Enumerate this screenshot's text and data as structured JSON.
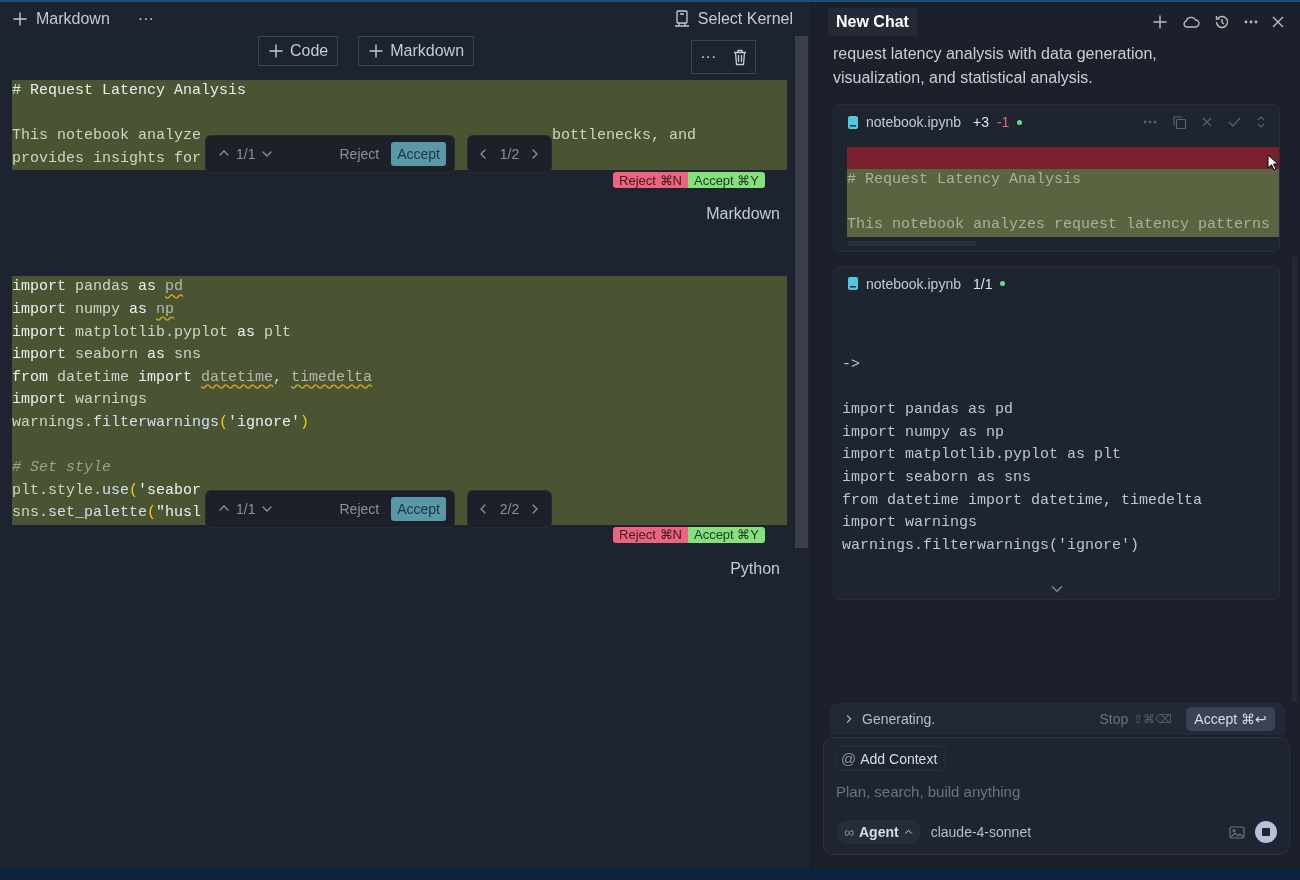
{
  "toolbar": {
    "add_label": "Markdown",
    "more": "···",
    "kernel": "Select Kernel"
  },
  "add_cell_buttons": [
    "Code",
    "Markdown"
  ],
  "cell_actions": {
    "more": "···"
  },
  "cells": [
    {
      "language": "Markdown",
      "added": true,
      "lines": [
        {
          "segments": [
            {
              "text": "# Request Latency Analysis",
              "kind": "heading"
            }
          ]
        },
        {
          "blank": true
        },
        {
          "segments": [
            {
              "text": "This notebook analyze"
            },
            {
              "text": "bottlenecks, and",
              "kind": "after_widget"
            }
          ]
        },
        {
          "segments": [
            {
              "text": "provides insights for"
            }
          ]
        }
      ],
      "review": {
        "hunk": "1/1",
        "reject": "Reject",
        "accept": "Accept",
        "position": "1/2"
      },
      "reject_badge": "Reject ⌘N",
      "accept_badge": "Accept ⌘Y"
    },
    {
      "language": "Python",
      "added": true,
      "lines": [
        {
          "segments": [
            {
              "text": "import",
              "kind": "kw"
            },
            {
              "text": " pandas "
            },
            {
              "text": "as ",
              "kind": "kw"
            },
            {
              "text": "pd",
              "kind": "warn"
            }
          ]
        },
        {
          "segments": [
            {
              "text": "import",
              "kind": "kw"
            },
            {
              "text": " numpy "
            },
            {
              "text": "as ",
              "kind": "kw"
            },
            {
              "text": "np",
              "kind": "warn"
            }
          ]
        },
        {
          "segments": [
            {
              "text": "import",
              "kind": "kw"
            },
            {
              "text": " matplotlib.pyplot "
            },
            {
              "text": "as",
              "kind": "kw"
            },
            {
              "text": " plt"
            }
          ]
        },
        {
          "segments": [
            {
              "text": "import",
              "kind": "kw"
            },
            {
              "text": " seaborn "
            },
            {
              "text": "as",
              "kind": "kw"
            },
            {
              "text": " sns"
            }
          ]
        },
        {
          "segments": [
            {
              "text": "from",
              "kind": "kw"
            },
            {
              "text": " datetime "
            },
            {
              "text": "import ",
              "kind": "kw"
            },
            {
              "text": "datetime",
              "kind": "warn"
            },
            {
              "text": ", "
            },
            {
              "text": "timedelta",
              "kind": "warn"
            }
          ]
        },
        {
          "segments": [
            {
              "text": "import",
              "kind": "kw"
            },
            {
              "text": " warnings"
            }
          ]
        },
        {
          "segments": [
            {
              "text": "warnings."
            },
            {
              "text": "filterwarnings",
              "kind": "fn"
            },
            {
              "text": "(",
              "kind": "paren"
            },
            {
              "text": "'ignore'",
              "kind": "str"
            },
            {
              "text": ")",
              "kind": "paren"
            }
          ]
        },
        {
          "blank": true
        },
        {
          "segments": [
            {
              "text": "# Set style",
              "kind": "comment"
            }
          ]
        },
        {
          "segments": [
            {
              "text": "plt.style."
            },
            {
              "text": "use",
              "kind": "fn"
            },
            {
              "text": "(",
              "kind": "paren"
            },
            {
              "text": "'seabor",
              "kind": "str"
            }
          ]
        },
        {
          "segments": [
            {
              "text": "sns."
            },
            {
              "text": "set_palette",
              "kind": "fn"
            },
            {
              "text": "(",
              "kind": "paren"
            },
            {
              "text": "\"husl",
              "kind": "str"
            }
          ]
        }
      ],
      "review": {
        "hunk": "1/1",
        "reject": "Reject",
        "accept": "Accept",
        "position": "2/2"
      },
      "reject_badge": "Reject ⌘N",
      "accept_badge": "Accept ⌘Y"
    }
  ],
  "chat": {
    "title": "New Chat",
    "message": "request latency analysis with data generation, visualization, and statistical analysis.",
    "diffs": [
      {
        "file": "notebook.ipynb",
        "added": "+3",
        "removed": "-1",
        "unsaved": true,
        "actions": true,
        "lines": [
          {
            "kind": "removed"
          },
          {
            "kind": "added",
            "text": "# Request Latency Analysis"
          },
          {
            "kind": "added"
          },
          {
            "kind": "added",
            "text": "This notebook analyzes request latency patterns"
          }
        ]
      },
      {
        "file": "notebook.ipynb",
        "count": "1/1",
        "unsaved": true,
        "actions": false,
        "lines": [
          {
            "kind": "context"
          },
          {
            "kind": "context"
          },
          {
            "kind": "context",
            "text": "->"
          },
          {
            "kind": "context"
          },
          {
            "kind": "context",
            "text": "import pandas as pd"
          },
          {
            "kind": "context",
            "text": "import numpy as np"
          },
          {
            "kind": "context",
            "text": "import matplotlib.pyplot as plt"
          },
          {
            "kind": "context",
            "text": "import seaborn as sns"
          },
          {
            "kind": "context",
            "text": "from datetime import datetime, timedelta"
          },
          {
            "kind": "context",
            "text": "import warnings"
          },
          {
            "kind": "context",
            "text": "warnings.filterwarnings('ignore')"
          }
        ]
      }
    ],
    "generation": {
      "status": "Generating.",
      "stop": "Stop",
      "stop_shortcut": "⇧⌘⌫",
      "accept": "Accept ⌘↩"
    },
    "composer": {
      "context_icon": "@",
      "context": "Add Context",
      "placeholder": "Plan, search, build anything",
      "mode_icon": "∞",
      "mode": "Agent",
      "model": "claude-4-sonnet"
    }
  }
}
